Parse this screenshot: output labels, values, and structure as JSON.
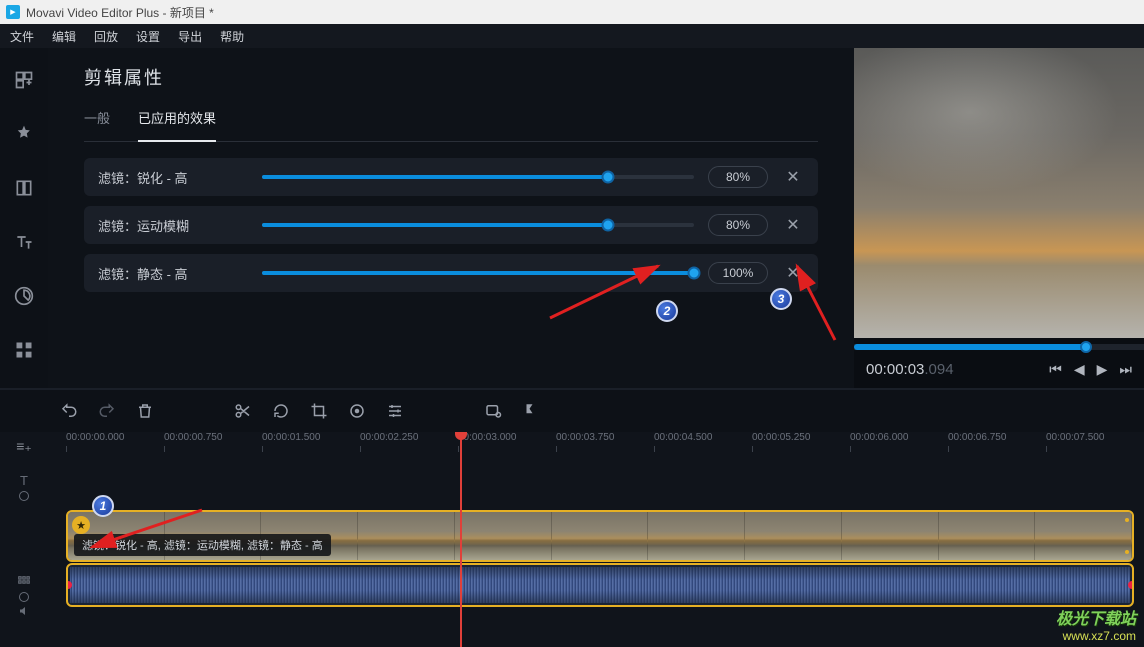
{
  "window": {
    "title": "Movavi Video Editor Plus - 新项目 *"
  },
  "menu": {
    "file": "文件",
    "edit": "编辑",
    "playback": "回放",
    "settings": "设置",
    "export": "导出",
    "help": "帮助"
  },
  "props": {
    "title": "剪辑属性",
    "tab_general": "一般",
    "tab_effects": "已应用的效果",
    "effects": [
      {
        "label": "滤镜：锐化 - 高",
        "percent": "80%",
        "fill": 80
      },
      {
        "label": "滤镜：运动模糊",
        "percent": "80%",
        "fill": 80
      },
      {
        "label": "滤镜：静态 - 高",
        "percent": "100%",
        "fill": 100
      }
    ]
  },
  "preview": {
    "time_main": "00:00:03",
    "time_ms": ".094"
  },
  "ruler": {
    "ticks": [
      "00:00:00.000",
      "00:00:00.750",
      "00:00:01.500",
      "00:00:02.250",
      "00:00:03.000",
      "00:00:03.750",
      "00:00:04.500",
      "00:00:05.250",
      "00:00:06.000",
      "00:00:06.750",
      "00:00:07.500"
    ]
  },
  "clip": {
    "overlay": "滤镜：锐化 - 高, 滤镜：运动模糊, 滤镜：静态 - 高"
  },
  "markers": {
    "one": "1",
    "two": "2",
    "three": "3"
  },
  "watermark": {
    "line1": "极光下载站",
    "line2": "www.xz7.com"
  }
}
